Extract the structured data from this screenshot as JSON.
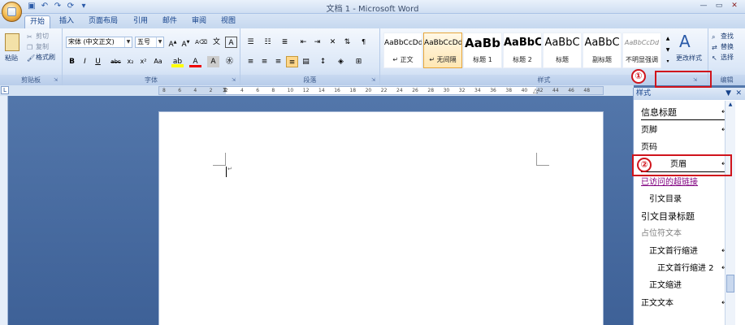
{
  "window": {
    "title": "文档 1 - Microsoft Word"
  },
  "quick_access": [
    "save-icon",
    "undo-icon",
    "redo-icon",
    "repeat-icon",
    "customize-icon"
  ],
  "tabs": [
    {
      "label": "开始",
      "active": true
    },
    {
      "label": "插入"
    },
    {
      "label": "页面布局"
    },
    {
      "label": "引用"
    },
    {
      "label": "邮件"
    },
    {
      "label": "审阅"
    },
    {
      "label": "视图"
    }
  ],
  "clipboard": {
    "paste": "粘贴",
    "cut": "剪切",
    "copy": "复制",
    "format_painter": "格式刷",
    "label": "剪贴板"
  },
  "font": {
    "name": "宋体 (中文正文)",
    "size": "五号",
    "label": "字体"
  },
  "paragraph": {
    "label": "段落"
  },
  "styles": {
    "label": "样式",
    "items": [
      {
        "sample": "AaBbCcDd",
        "name": "↵ 正文"
      },
      {
        "sample": "AaBbCcDd",
        "name": "↵ 无间隔",
        "selected": true
      },
      {
        "sample": "AaBb",
        "name": "标题 1"
      },
      {
        "sample": "AaBbC",
        "name": "标题 2"
      },
      {
        "sample": "AaBbC",
        "name": "标题"
      },
      {
        "sample": "AaBbC",
        "name": "副标题"
      },
      {
        "sample": "AaBbCcDd",
        "name": "不明显强调"
      }
    ],
    "change_styles": "更改样式"
  },
  "editing": {
    "find": "查找",
    "replace": "替换",
    "select": "选择",
    "label": "编辑"
  },
  "ruler": [
    "8",
    "6",
    "4",
    "2",
    "2",
    "4",
    "6",
    "8",
    "10",
    "12",
    "14",
    "16",
    "18",
    "20",
    "22",
    "24",
    "26",
    "28",
    "30",
    "32",
    "34",
    "36",
    "38",
    "40",
    "42",
    "44",
    "46",
    "48"
  ],
  "styles_pane": {
    "title": "样式",
    "items": [
      {
        "label": "信息标题",
        "mark": "↵a"
      },
      {
        "label": "页脚",
        "mark": "↵a"
      },
      {
        "label": "页码",
        "mark": "a"
      },
      {
        "label": "页眉",
        "mark": "↵a"
      },
      {
        "label": "已访问的超链接",
        "mark": "a"
      },
      {
        "label": "引文目录",
        "mark": "↵"
      },
      {
        "label": "引文目录标题",
        "mark": "↵"
      },
      {
        "label": "占位符文本",
        "mark": "a"
      },
      {
        "label": "正文首行缩进",
        "mark": "↵a"
      },
      {
        "label": "正文首行缩进 2",
        "mark": "↵a"
      },
      {
        "label": "正文缩进",
        "mark": "↵"
      },
      {
        "label": "正文文本",
        "mark": "↵a"
      }
    ]
  },
  "annotations": {
    "one": "①",
    "two": "②"
  },
  "colors": {
    "accent": "#d0141c",
    "ribbon": "#dbe7f7",
    "highlight": "#ffe7b3"
  }
}
